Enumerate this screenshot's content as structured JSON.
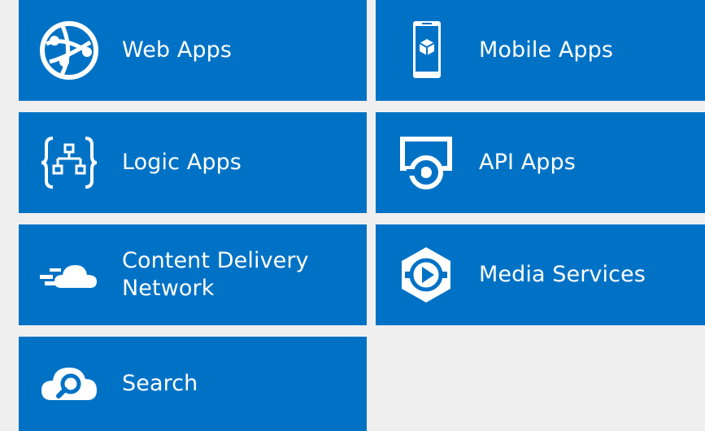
{
  "colors": {
    "tile_bg": "#0072c6",
    "page_bg": "#efefef",
    "text": "#ffffff"
  },
  "tiles": [
    {
      "label": "Web Apps",
      "icon": "globe-network-icon"
    },
    {
      "label": "Mobile Apps",
      "icon": "mobile-device-icon"
    },
    {
      "label": "Logic Apps",
      "icon": "logic-braces-icon"
    },
    {
      "label": "API Apps",
      "icon": "api-screen-icon"
    },
    {
      "label": "Content Delivery\nNetwork",
      "icon": "cloud-speed-icon"
    },
    {
      "label": "Media Services",
      "icon": "media-play-hexagon-icon"
    },
    {
      "label": "Search",
      "icon": "cloud-search-icon"
    }
  ]
}
